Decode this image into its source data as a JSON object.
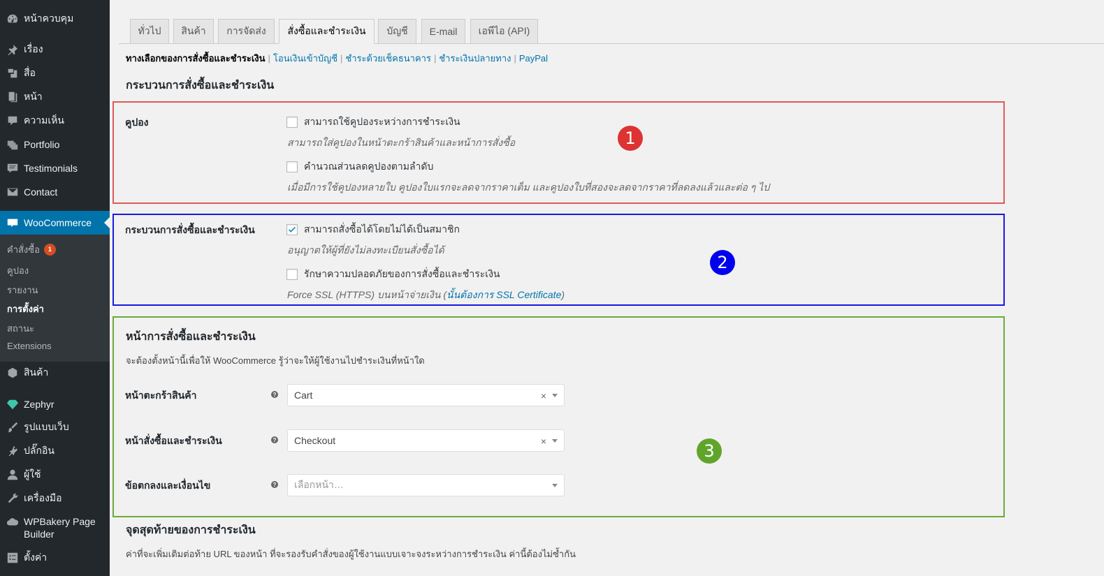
{
  "sidebar": {
    "items": [
      {
        "label": "หน้าควบคุม",
        "icon": "dashboard-icon"
      },
      {
        "label": "เรื่อง",
        "icon": "pin-icon"
      },
      {
        "label": "สื่อ",
        "icon": "media-icon"
      },
      {
        "label": "หน้า",
        "icon": "page-icon"
      },
      {
        "label": "ความเห็น",
        "icon": "comment-icon"
      },
      {
        "label": "Portfolio",
        "icon": "portfolio-icon"
      },
      {
        "label": "Testimonials",
        "icon": "testimonials-icon"
      },
      {
        "label": "Contact",
        "icon": "mail-icon"
      },
      {
        "label": "WooCommerce",
        "icon": "woo-icon"
      },
      {
        "label": "สินค้า",
        "icon": "product-icon"
      },
      {
        "label": "Zephyr",
        "icon": "diamond-icon"
      },
      {
        "label": "รูปแบบเว็บ",
        "icon": "brush-icon"
      },
      {
        "label": "ปลั๊กอิน",
        "icon": "plugin-icon"
      },
      {
        "label": "ผู้ใช้",
        "icon": "user-icon"
      },
      {
        "label": "เครื่องมือ",
        "icon": "wrench-icon"
      },
      {
        "label": "WPBakery Page Builder",
        "icon": "cloud-icon"
      },
      {
        "label": "ตั้งค่า",
        "icon": "settings-icon"
      }
    ],
    "submenu": [
      {
        "label": "คำสั่งซื้อ",
        "badge": "1"
      },
      {
        "label": "คูปอง"
      },
      {
        "label": "รายงาน"
      },
      {
        "label": "การตั้งค่า"
      },
      {
        "label": "สถานะ"
      },
      {
        "label": "Extensions"
      }
    ]
  },
  "tabs": [
    "ทั่วไป",
    "สินค้า",
    "การจัดส่ง",
    "สั่งซื้อและชำระเงิน",
    "บัญชี",
    "E-mail",
    "เอพีไอ (API)"
  ],
  "subsub": {
    "current": "ทางเลือกของการสั่งซื้อและชำระเงิน",
    "links": [
      "โอนเงินเข้าบัญชี",
      "ชำระด้วยเช็คธนาคาร",
      "ชำระเงินปลายทาง",
      "PayPal"
    ]
  },
  "section_title": "กระบวนการสั่งซื้อและชำระเงิน",
  "coupon": {
    "label": "คูปอง",
    "opt1": "สามารถใช้คูปองระหว่างการชำระเงิน",
    "desc1": "สามารถใส่คูปองในหน้าตะกร้าสินค้าและหน้าการสั่งซื้อ",
    "opt2": "คำนวณส่วนลดคูปองตามลำดับ",
    "desc2": "เมื่อมีการใช้คูปองหลายใบ คูปองใบแรกจะลดจากราคาเต็ม และคูปองใบที่สองจะลดจากราคาที่ลดลงแล้วและต่อ ๆ ไป"
  },
  "checkout_process": {
    "label": "กระบวนการสั่งซื้อและชำระเงิน",
    "opt1": "สามารถสั่งซื้อได้โดยไม่ได้เป็นสมาชิก",
    "desc1": "อนุญาตให้ผู้ที่ยังไม่ลงทะเบียนสั่งซื้อได้",
    "opt2": "รักษาความปลอดภัยของการสั่งซื้อและชำระเงิน",
    "desc2_prefix": "Force SSL (HTTPS) บนหน้าจ่ายเงิน (",
    "desc2_link": "นั้นต้องการ SSL Certificate",
    "desc2_suffix": ")"
  },
  "checkout_pages": {
    "title": "หน้าการสั่งซื้อและชำระเงิน",
    "intro": "จะต้องตั้งหน้านี้เพื่อให้ WooCommerce รู้ว่าจะให้ผู้ใช้งานไปชำระเงินที่หน้าใด",
    "cart_label": "หน้าตะกร้าสินค้า",
    "cart_value": "Cart",
    "checkout_label": "หน้าสั่งซื้อและชำระเงิน",
    "checkout_value": "Checkout",
    "terms_label": "ข้อตกลงและเงื่อนไข",
    "terms_placeholder": "เลือกหน้า…",
    "help": "?",
    "clear": "×"
  },
  "endpoints": {
    "title": "จุดสุดท้ายของการชำระเงิน",
    "desc": "ค่าที่จะเพิ่มเติมต่อท้าย URL ของหน้า ที่จะรองรับคำสั่งของผู้ใช้งานแบบเจาะจงระหว่างการชำระเงิน ค่านี้ต้องไม่ซ้ำกัน"
  },
  "markers": [
    {
      "label": "1",
      "color": "#dd3333"
    },
    {
      "label": "2",
      "color": "#0000ee"
    },
    {
      "label": "3",
      "color": "#5fa52c"
    }
  ],
  "colors": {
    "box1": "#e05a5a",
    "box2": "#1a1adf",
    "box3": "#6aaa3a",
    "accent": "#0073aa"
  }
}
